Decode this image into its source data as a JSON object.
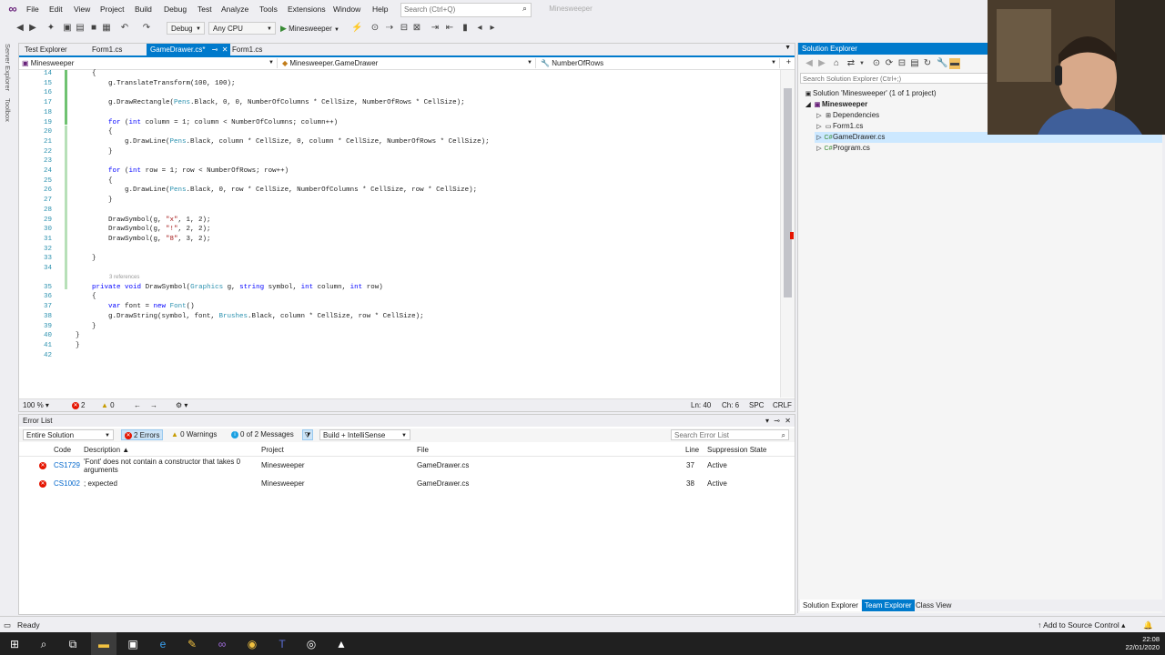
{
  "menu": {
    "items": [
      "File",
      "Edit",
      "View",
      "Project",
      "Build",
      "Debug",
      "Test",
      "Analyze",
      "Tools",
      "Extensions",
      "Window",
      "Help"
    ],
    "search_placeholder": "Search (Ctrl+Q)",
    "solution_badge": "Minesweeper"
  },
  "toolbar": {
    "config": "Debug",
    "platform": "Any CPU",
    "run_label": "Minesweeper"
  },
  "side_rails": {
    "left_top": "Server Explorer",
    "left_bottom": "Toolbox"
  },
  "editor": {
    "tabs": [
      {
        "label": "Test Explorer"
      },
      {
        "label": "Form1.cs"
      },
      {
        "label": "GameDrawer.cs*"
      },
      {
        "label": "Form1.cs"
      }
    ],
    "nav": {
      "project": "Minesweeper",
      "class": "Minesweeper.GameDrawer",
      "member": "NumberOfRows"
    },
    "ref_hint": "3 references",
    "lines": [
      {
        "n": "14",
        "text": "    {"
      },
      {
        "n": "15",
        "text": "        g.TranslateTransform(100, 100);"
      },
      {
        "n": "16",
        "text": ""
      },
      {
        "n": "17",
        "text": "        g.DrawRectangle(Pens.Black, 0, 0, NumberOfColumns * CellSize, NumberOfRows * CellSize);"
      },
      {
        "n": "18",
        "text": ""
      },
      {
        "n": "19",
        "text": "        for (int column = 1; column < NumberOfColumns; column++)"
      },
      {
        "n": "20",
        "text": "        {"
      },
      {
        "n": "21",
        "text": "            g.DrawLine(Pens.Black, column * CellSize, 0, column * CellSize, NumberOfRows * CellSize);"
      },
      {
        "n": "22",
        "text": "        }"
      },
      {
        "n": "23",
        "text": ""
      },
      {
        "n": "24",
        "text": "        for (int row = 1; row < NumberOfRows; row++)"
      },
      {
        "n": "25",
        "text": "        {"
      },
      {
        "n": "26",
        "text": "            g.DrawLine(Pens.Black, 0, row * CellSize, NumberOfColumns * CellSize, row * CellSize);"
      },
      {
        "n": "27",
        "text": "        }"
      },
      {
        "n": "28",
        "text": ""
      },
      {
        "n": "29",
        "text": "        DrawSymbol(g, \"x\", 1, 2);"
      },
      {
        "n": "30",
        "text": "        DrawSymbol(g, \"!\", 2, 2);"
      },
      {
        "n": "31",
        "text": "        DrawSymbol(g, \"8\", 3, 2);"
      },
      {
        "n": "32",
        "text": ""
      },
      {
        "n": "33",
        "text": "    }"
      },
      {
        "n": "34",
        "text": ""
      },
      {
        "n": "35",
        "text": "    private void DrawSymbol(Graphics g, string symbol, int column, int row)"
      },
      {
        "n": "36",
        "text": "    {"
      },
      {
        "n": "37",
        "text": "        var font = new Font()"
      },
      {
        "n": "38",
        "text": "        g.DrawString(symbol, font, Brushes.Black, column * CellSize, row * CellSize);"
      },
      {
        "n": "39",
        "text": "    }"
      },
      {
        "n": "40",
        "text": "}"
      },
      {
        "n": "41",
        "text": "}"
      },
      {
        "n": "42",
        "text": ""
      }
    ],
    "status": {
      "zoom": "100 %",
      "errors": "2",
      "warnings": "0",
      "ln": "Ln: 40",
      "ch": "Ch: 6",
      "ins": "SPC",
      "eol": "CRLF"
    }
  },
  "error_list": {
    "title": "Error List",
    "scope": "Entire Solution",
    "errors_btn": "2 Errors",
    "warnings_btn": "0 Warnings",
    "messages_btn": "0 of 2 Messages",
    "build_filter": "Build + IntelliSense",
    "search_placeholder": "Search Error List",
    "columns": [
      "Code",
      "Description",
      "Project",
      "File",
      "Line",
      "Suppression State"
    ],
    "rows": [
      {
        "code": "CS1729",
        "desc1": "'Font' does not contain a constructor that takes 0",
        "desc2": "arguments",
        "project": "Minesweeper",
        "file": "GameDrawer.cs",
        "line": "37",
        "state": "Active"
      },
      {
        "code": "CS1002",
        "desc1": "; expected",
        "desc2": "",
        "project": "Minesweeper",
        "file": "GameDrawer.cs",
        "line": "38",
        "state": "Active"
      }
    ]
  },
  "solution_explorer": {
    "title": "Solution Explorer",
    "search_placeholder": "Search Solution Explorer (Ctrl+;)",
    "tree": [
      {
        "label": "Solution 'Minesweeper' (1 of 1 project)",
        "depth": 0
      },
      {
        "label": "Minesweeper",
        "depth": 1
      },
      {
        "label": "Dependencies",
        "depth": 2
      },
      {
        "label": "Form1.cs",
        "depth": 2
      },
      {
        "label": "GameDrawer.cs",
        "depth": 2
      },
      {
        "label": "Program.cs",
        "depth": 2
      }
    ],
    "tabs": [
      "Solution Explorer",
      "Team Explorer",
      "Class View"
    ]
  },
  "statusbar": {
    "state": "Ready",
    "source_control": "Add to Source Control"
  },
  "taskbar": {
    "time": "22:08",
    "date": "22/01/2020"
  },
  "colors": {
    "accent": "#007acc",
    "error": "#e51400",
    "keyword": "#0000ff",
    "type": "#2b91af",
    "string": "#a31515"
  }
}
